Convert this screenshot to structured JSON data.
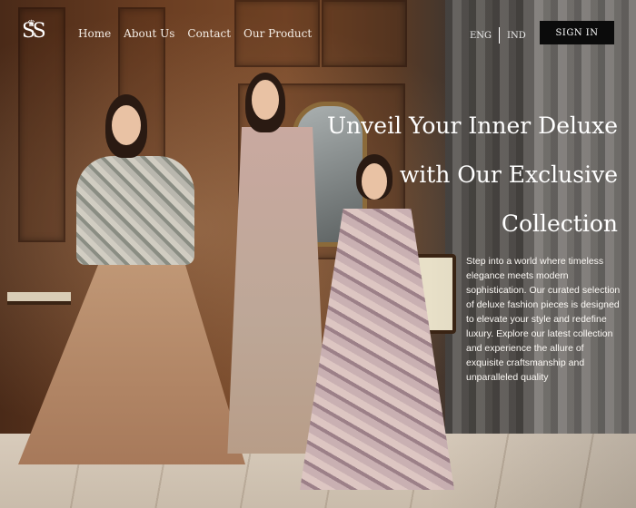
{
  "brand": {
    "logo_text": "SS",
    "crown_glyph": "♛"
  },
  "nav": {
    "items": [
      {
        "label": "Home"
      },
      {
        "label": "About Us"
      },
      {
        "label": "Contact"
      },
      {
        "label": "Our Product"
      }
    ]
  },
  "language": {
    "options": [
      "ENG",
      "IND"
    ]
  },
  "auth": {
    "signin_label": "SIGN IN"
  },
  "hero": {
    "headline_lines": [
      "Unveil Your Inner Deluxe",
      "with Our Exclusive",
      "Collection"
    ],
    "description": "Step into a world where timeless elegance meets modern sophistication. Our curated selection of deluxe fashion pieces is designed to elevate your style and redefine luxury. Explore our latest collection and experience the allure of exquisite craftsmanship and unparalleled quality"
  }
}
